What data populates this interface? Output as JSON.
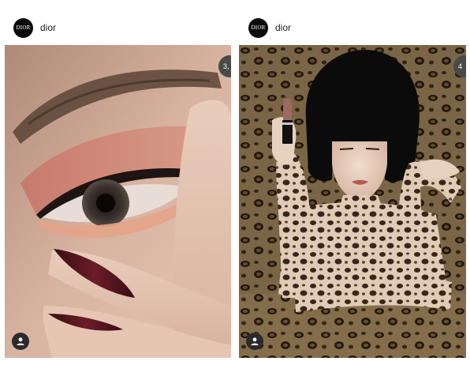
{
  "posts": [
    {
      "avatar_text": "DIOR",
      "account": "dior",
      "counter": "3,",
      "image": "eye-makeup-photo",
      "user_icon": "person-icon"
    },
    {
      "avatar_text": "DIOR",
      "account": "dior",
      "counter": "4",
      "image": "leopard-lipstick-photo",
      "user_icon": "person-icon"
    }
  ],
  "colors": {
    "avatar_bg": "#0b0b0b",
    "badge_bg": "#4a4a4a",
    "user_button_bg": "#2b2b2b"
  }
}
